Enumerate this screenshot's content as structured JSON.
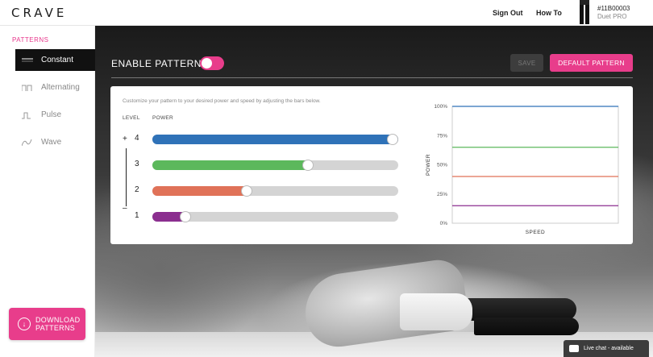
{
  "header": {
    "logo": "CRAVE",
    "nav": [
      "Sign Out",
      "How To"
    ],
    "device_id": "#11B00003",
    "device_name": "Duet PRO"
  },
  "sidebar": {
    "heading": "PATTERNS",
    "items": [
      {
        "label": "Constant",
        "icon": "constant-icon",
        "active": true
      },
      {
        "label": "Alternating",
        "icon": "alternating-icon",
        "active": false
      },
      {
        "label": "Pulse",
        "icon": "pulse-icon",
        "active": false
      },
      {
        "label": "Wave",
        "icon": "wave-icon",
        "active": false
      }
    ],
    "download_label_line1": "DOWNLOAD",
    "download_label_line2": "PATTERNS"
  },
  "toolbar": {
    "enable_label": "ENABLE PATTERN",
    "enabled": true,
    "save_label": "SAVE",
    "default_label": "DEFAULT PATTERN"
  },
  "editor": {
    "instructions": "Customize your pattern to your desired power and speed by adjusting the bars below.",
    "level_header": "LEVEL",
    "power_header": "POWER",
    "plus": "+",
    "minus": "–",
    "levels": [
      {
        "level": "4",
        "power": 1.0,
        "color": "#2f72b8"
      },
      {
        "level": "3",
        "power": 0.65,
        "color": "#5cb85c"
      },
      {
        "level": "2",
        "power": 0.4,
        "color": "#e07258"
      },
      {
        "level": "1",
        "power": 0.15,
        "color": "#8b2e8f"
      }
    ]
  },
  "chart_data": {
    "type": "line",
    "xlabel": "SPEED",
    "ylabel": "POWER",
    "yticks": [
      "100%",
      "75%",
      "50%",
      "25%",
      "0%"
    ],
    "ylim": [
      0,
      100
    ],
    "series": [
      {
        "values": [
          100,
          100
        ],
        "color": "#2f72b8"
      },
      {
        "values": [
          65,
          65
        ],
        "color": "#5cb85c"
      },
      {
        "values": [
          40,
          40
        ],
        "color": "#e07258"
      },
      {
        "values": [
          15,
          15
        ],
        "color": "#8b2e8f"
      }
    ]
  },
  "livechat": {
    "label": "Live chat - available"
  },
  "colors": {
    "accent": "#e83d8b",
    "sidebar_active": "#111111"
  }
}
